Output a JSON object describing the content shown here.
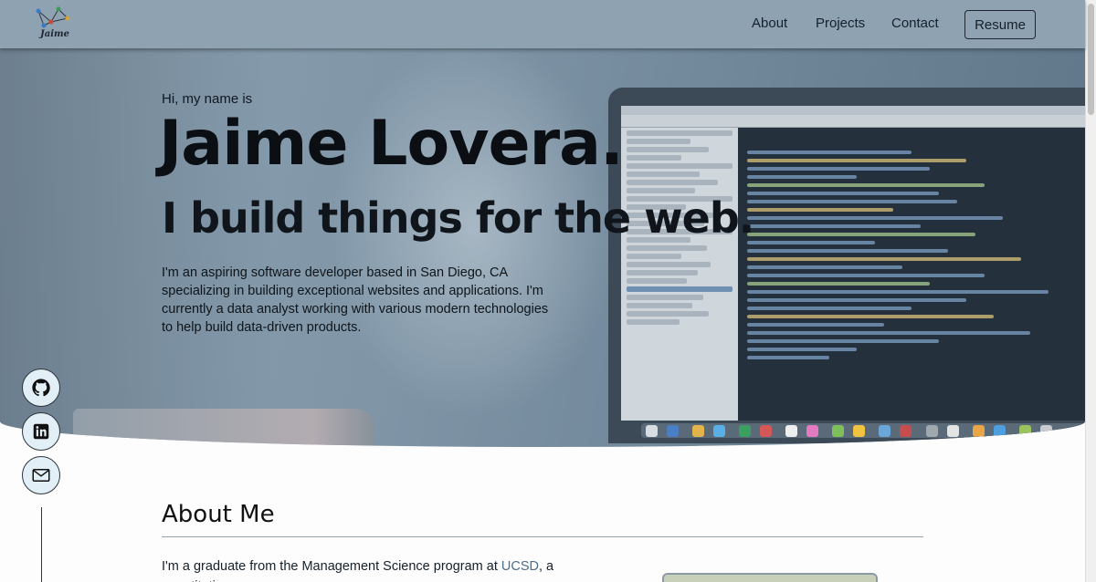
{
  "nav": {
    "logo_text": "Jaime",
    "links": [
      "About",
      "Projects",
      "Contact"
    ],
    "resume_label": "Resume"
  },
  "hero": {
    "greeting": "Hi, my name is",
    "name": "Jaime Lovera.",
    "tagline": "I build things for the web.",
    "intro": "I'm an aspiring software developer based in San Diego, CA specializing in building exceptional websites and applications. I'm currently a data analyst working with various modern technologies to help build data-driven products."
  },
  "social": {
    "icons": [
      "github-icon",
      "linkedin-icon",
      "mail-icon"
    ]
  },
  "about": {
    "title": "About Me",
    "text_before_link": "I'm a graduate from the Management Science program at ",
    "link_text": "UCSD",
    "text_after_link": ", a quantitative"
  },
  "colors": {
    "nav_bg": "#8fa2b1",
    "hero_bg": "#7f95a6",
    "social_bg": "#e3eff7",
    "link": "#4a6e8c"
  }
}
